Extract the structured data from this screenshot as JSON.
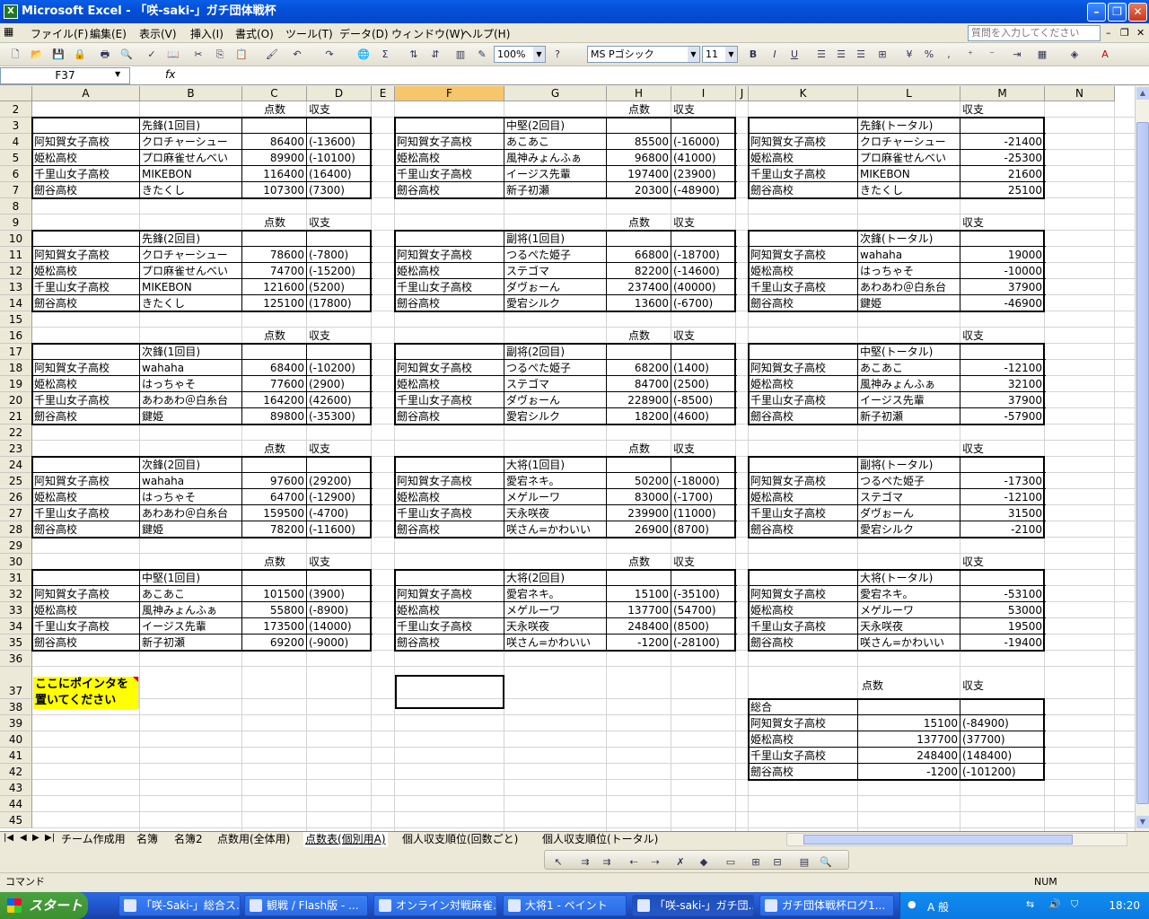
{
  "window": {
    "title": "Microsoft Excel - 「咲-saki-」ガチ団体戦杯"
  },
  "menu": {
    "items": [
      "ファイル(F)",
      "編集(E)",
      "表示(V)",
      "挿入(I)",
      "書式(O)",
      "ツール(T)",
      "データ(D)",
      "ウィンドウ(W)",
      "ヘルプ(H)"
    ],
    "help_placeholder": "質問を入力してください"
  },
  "toolbar": {
    "zoom": "100%",
    "font": "MS Pゴシック",
    "size": "11",
    "bold": "B",
    "italic": "I",
    "underline": "U"
  },
  "formula": {
    "namebox": "F37",
    "fx": "fx"
  },
  "grid": {
    "columns": [
      "A",
      "B",
      "C",
      "D",
      "E",
      "F",
      "G",
      "H",
      "I",
      "J",
      "K",
      "L",
      "M",
      "N"
    ],
    "selected_column": "F",
    "rows": [
      "2",
      "3",
      "4",
      "5",
      "6",
      "7",
      "8",
      "9",
      "10",
      "11",
      "12",
      "13",
      "14",
      "15",
      "16",
      "17",
      "18",
      "19",
      "20",
      "21",
      "22",
      "23",
      "24",
      "25",
      "26",
      "27",
      "28",
      "29",
      "30",
      "31",
      "32",
      "33",
      "34",
      "35",
      "36",
      "37",
      "38",
      "39",
      "40",
      "41",
      "42",
      "43",
      "44",
      "45"
    ],
    "header_score": "点数",
    "header_balance": "収支",
    "schools": [
      "阿知賀女子高校",
      "姫松高校",
      "千里山女子高校",
      "劒谷高校"
    ],
    "blocks": [
      {
        "title": "先鋒(1回目)",
        "players": [
          "クロチャーシュー",
          "プロ麻雀せんべい",
          "MIKEBON",
          "きたくし"
        ],
        "scores": [
          "86400",
          "89900",
          "116400",
          "107300"
        ],
        "balances": [
          "(-13600)",
          "(-10100)",
          "(16400)",
          "(7300)"
        ]
      },
      {
        "title": "先鋒(2回目)",
        "players": [
          "クロチャーシュー",
          "プロ麻雀せんべい",
          "MIKEBON",
          "きたくし"
        ],
        "scores": [
          "78600",
          "74700",
          "121600",
          "125100"
        ],
        "balances": [
          "(-7800)",
          "(-15200)",
          "(5200)",
          "(17800)"
        ]
      },
      {
        "title": "次鋒(1回目)",
        "players": [
          "wahaha",
          "はっちゃそ",
          "あわあわ＠白糸台",
          "鍵姫"
        ],
        "scores": [
          "68400",
          "77600",
          "164200",
          "89800"
        ],
        "balances": [
          "(-10200)",
          "(2900)",
          "(42600)",
          "(-35300)"
        ]
      },
      {
        "title": "次鋒(2回目)",
        "players": [
          "wahaha",
          "はっちゃそ",
          "あわあわ＠白糸台",
          "鍵姫"
        ],
        "scores": [
          "97600",
          "64700",
          "159500",
          "78200"
        ],
        "balances": [
          "(29200)",
          "(-12900)",
          "(-4700)",
          "(-11600)"
        ]
      },
      {
        "title": "中堅(1回目)",
        "players": [
          "あこあこ",
          "風神みょんふぁ",
          "イージス先輩",
          "新子初瀬"
        ],
        "scores": [
          "101500",
          "55800",
          "173500",
          "69200"
        ],
        "balances": [
          "(3900)",
          "(-8900)",
          "(14000)",
          "(-9000)"
        ]
      },
      {
        "title": "中堅(2回目)",
        "players": [
          "あこあこ",
          "風神みょんふぁ",
          "イージス先輩",
          "新子初瀬"
        ],
        "scores": [
          "85500",
          "96800",
          "197400",
          "20300"
        ],
        "balances": [
          "(-16000)",
          "(41000)",
          "(23900)",
          "(-48900)"
        ]
      },
      {
        "title": "副将(1回目)",
        "players": [
          "つるぺた姫子",
          "ステゴマ",
          "ダヴぉーん",
          "愛宕シルク"
        ],
        "scores": [
          "66800",
          "82200",
          "237400",
          "13600"
        ],
        "balances": [
          "(-18700)",
          "(-14600)",
          "(40000)",
          "(-6700)"
        ]
      },
      {
        "title": "副将(2回目)",
        "players": [
          "つるぺた姫子",
          "ステゴマ",
          "ダヴぉーん",
          "愛宕シルク"
        ],
        "scores": [
          "68200",
          "84700",
          "228900",
          "18200"
        ],
        "balances": [
          "(1400)",
          "(2500)",
          "(-8500)",
          "(4600)"
        ]
      },
      {
        "title": "大将(1回目)",
        "players": [
          "愛宕ネキ。",
          "メゲルーワ",
          "天永咲夜",
          "咲さん=かわいい"
        ],
        "scores": [
          "50200",
          "83000",
          "239900",
          "26900"
        ],
        "balances": [
          "(-18000)",
          "(-1700)",
          "(11000)",
          "(8700)"
        ]
      },
      {
        "title": "大将(2回目)",
        "players": [
          "愛宕ネキ。",
          "メゲルーワ",
          "天永咲夜",
          "咲さん=かわいい"
        ],
        "scores": [
          "15100",
          "137700",
          "248400",
          "-1200"
        ],
        "balances": [
          "(-35100)",
          "(54700)",
          "(8500)",
          "(-28100)"
        ]
      }
    ],
    "totals": [
      {
        "title": "先鋒(トータル)",
        "players": [
          "クロチャーシュー",
          "プロ麻雀せんべい",
          "MIKEBON",
          "きたくし"
        ],
        "values": [
          "-21400",
          "-25300",
          "21600",
          "25100"
        ]
      },
      {
        "title": "次鋒(トータル)",
        "players": [
          "wahaha",
          "はっちゃそ",
          "あわあわ＠白糸台",
          "鍵姫"
        ],
        "values": [
          "19000",
          "-10000",
          "37900",
          "-46900"
        ]
      },
      {
        "title": "中堅(トータル)",
        "players": [
          "あこあこ",
          "風神みょんふぁ",
          "イージス先輩",
          "新子初瀬"
        ],
        "values": [
          "-12100",
          "32100",
          "37900",
          "-57900"
        ]
      },
      {
        "title": "副将(トータル)",
        "players": [
          "つるぺた姫子",
          "ステゴマ",
          "ダヴぉーん",
          "愛宕シルク"
        ],
        "values": [
          "-17300",
          "-12100",
          "31500",
          "-2100"
        ]
      },
      {
        "title": "大将(トータル)",
        "players": [
          "愛宕ネキ。",
          "メゲルーワ",
          "天永咲夜",
          "咲さん=かわいい"
        ],
        "values": [
          "-53100",
          "53000",
          "19500",
          "-19400"
        ]
      }
    ],
    "overall": {
      "title": "総合",
      "scores": [
        "15100",
        "137700",
        "248400",
        "-1200"
      ],
      "balances": [
        "(-84900)",
        "(37700)",
        "(148400)",
        "(-101200)"
      ]
    },
    "comment": {
      "line1": "ここにポインタを",
      "line2": "置いてください"
    }
  },
  "sheets": {
    "tabs": [
      "チーム作成用",
      "名簿",
      "名簿2",
      "点数用(全体用)",
      "点数表(個別用A)",
      "個人収支順位(回数ごと)",
      "個人収支順位(トータル)"
    ],
    "active": 4
  },
  "status": {
    "left": "コマンド",
    "num": "NUM"
  },
  "taskbar": {
    "start": "スタート",
    "tasks": [
      "「咲-Saki-」総合ス...",
      "観戦 / Flash版 - ...",
      "オンライン対戦麻雀...",
      "大将1 - ペイント",
      "「咲-saki-」ガチ団...",
      "ガチ団体戦杯ログ1..."
    ],
    "active_task": 4,
    "clock": "18:20",
    "ime": "A 般"
  }
}
